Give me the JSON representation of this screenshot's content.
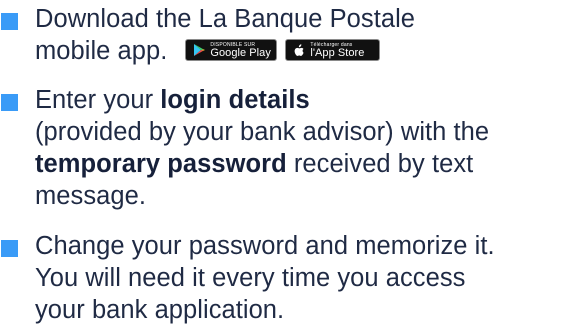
{
  "steps": [
    {
      "lines": [
        "Download the La Banque Postale",
        "mobile app."
      ]
    },
    {
      "line1": "Enter your ",
      "line1_bold": "login details",
      "line2": "(provided by your bank advisor) with the",
      "line3_bold": "temporary password",
      "line3": " received by text",
      "line4": "message."
    },
    {
      "lines": [
        "Change your password and memorize it.",
        "You will need it every time you access",
        "your bank application."
      ]
    }
  ],
  "badges": {
    "google_play": {
      "small": "DISPONIBLE SUR",
      "big": "Google Play"
    },
    "app_store": {
      "small": "Télécharger dans",
      "big": "l'App Store"
    }
  },
  "colors": {
    "bullet": "#3a9bf7",
    "text": "#1f2a44"
  },
  "icons": {
    "bullet": "square-bullet-icon",
    "google_play": "google-play-icon",
    "app_store": "apple-icon"
  }
}
